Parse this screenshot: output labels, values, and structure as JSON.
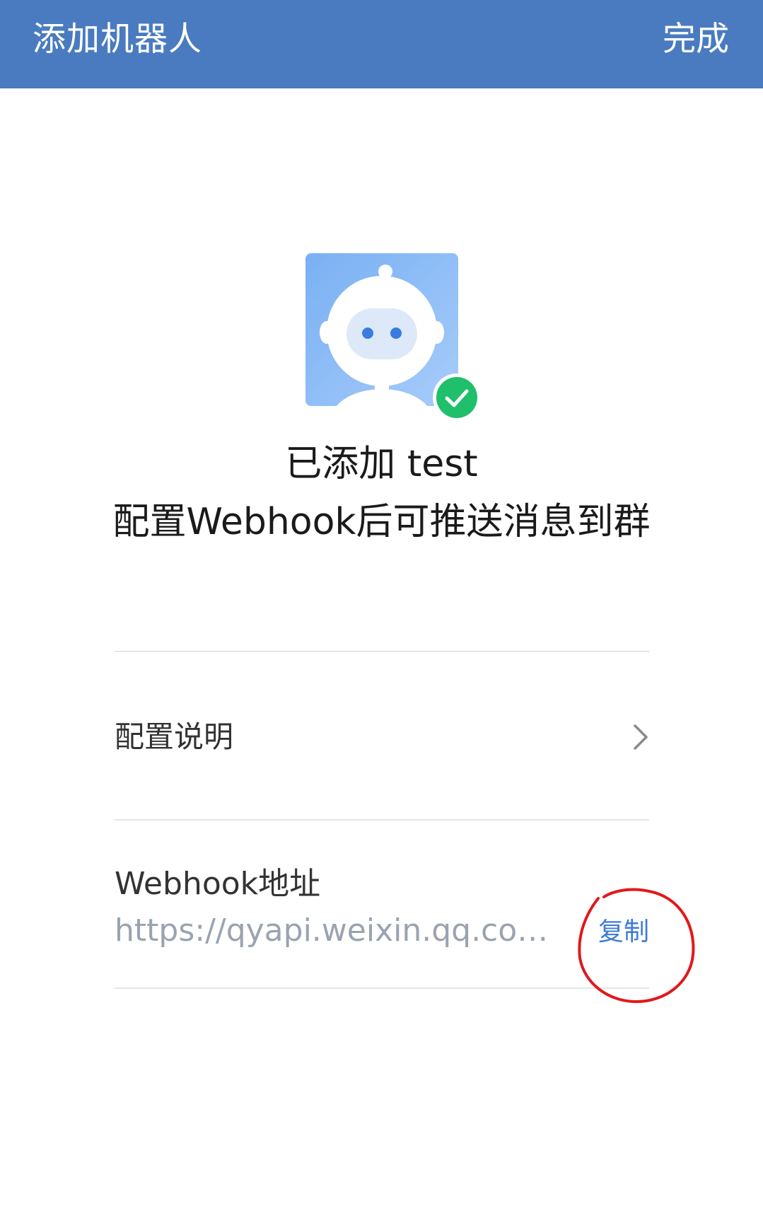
{
  "header": {
    "title": "添加机器人",
    "done_label": "完成",
    "background_color": "#4a7bc0"
  },
  "robot": {
    "icon": "robot-icon",
    "badge_icon": "check-circle-icon",
    "badge_color": "#1fbf6b"
  },
  "status": {
    "added_text": "已添加 test",
    "hint_text": "配置Webhook后可推送消息到群"
  },
  "config_row": {
    "label": "配置说明",
    "icon": "chevron-right-icon"
  },
  "webhook": {
    "label": "Webhook地址",
    "url": "https://qyapi.weixin.qq.com/cgi-bin/webhook/send",
    "copy_label": "复制",
    "copy_color": "#3e7bd6"
  },
  "annotation": {
    "color": "#e0191c"
  }
}
